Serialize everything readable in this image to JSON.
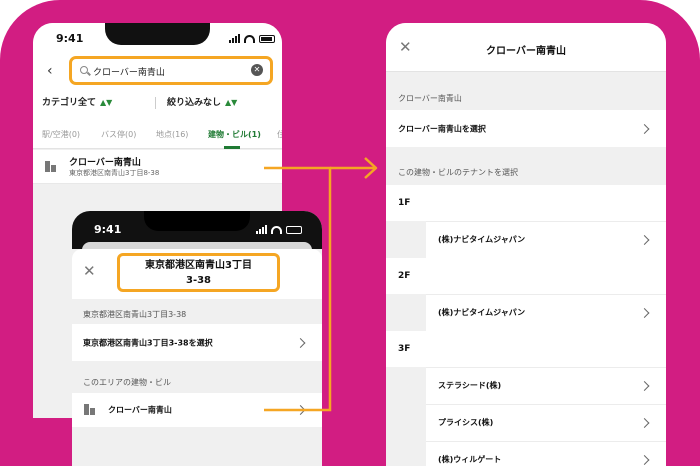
{
  "search_screen": {
    "time": "9:41",
    "back_icon": "chevron-left-icon",
    "search_value": "クローバー南青山",
    "clear_icon": "clear-circle-icon",
    "filters": [
      {
        "label": "カテゴリ全て",
        "icon": "sort-arrows-icon"
      },
      {
        "label": "絞り込みなし",
        "icon": "sort-arrows-icon"
      }
    ],
    "tabs": [
      {
        "label": "駅/空港(0)",
        "active": false
      },
      {
        "label": "バス停(0)",
        "active": false
      },
      {
        "label": "地点(16)",
        "active": false
      },
      {
        "label": "建物・ビル(1)",
        "active": true
      },
      {
        "label": "住",
        "active": false
      }
    ],
    "result": {
      "name": "クローバー南青山",
      "address": "東京都港区南青山3丁目8-38",
      "icon": "building-icon"
    }
  },
  "address_screen": {
    "time": "9:41",
    "close_icon": "close-icon",
    "title_line1": "東京都港区南青山3丁目",
    "title_line2": "3-38",
    "section1_header": "東京都港区南青山3丁目3-38",
    "select_row": "東京都港区南青山3丁目3-38を選択",
    "section2_header": "このエリアの建物・ビル",
    "building_row": "クローバー南青山"
  },
  "detail_screen": {
    "close_icon": "close-icon",
    "title": "クローバー南青山",
    "section1_header": "クローバー南青山",
    "select_row": "クローバー南青山を選択",
    "section2_header": "この建物・ビルのテナントを選択",
    "floors": [
      {
        "label": "1F",
        "tenants": [
          "(株)ナビタイムジャパン"
        ]
      },
      {
        "label": "2F",
        "tenants": [
          "(株)ナビタイムジャパン"
        ]
      },
      {
        "label": "3F",
        "tenants": [
          "ステラシード(株)",
          "プライシス(株)",
          "(株)ウィルゲート"
        ]
      }
    ]
  },
  "colors": {
    "background": "#d21d82",
    "highlight": "#f5a623",
    "active_tab": "#1f7a33"
  }
}
